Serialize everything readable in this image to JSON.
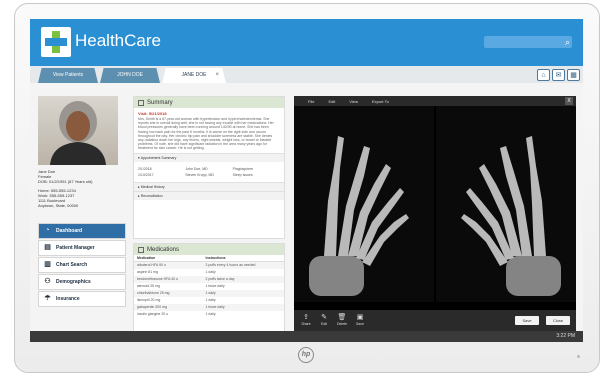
{
  "app": {
    "brand": "HealthCare"
  },
  "colors": {
    "topbar": "#2b8fd4",
    "nav_active": "#2f6fa6",
    "visit_date": "#c0392b"
  },
  "tabs": [
    {
      "label": "View Patients",
      "active": false
    },
    {
      "label": "JOHN DOE",
      "active": false
    },
    {
      "label": "JANE DOE",
      "active": true,
      "close": "×"
    }
  ],
  "header_icons": [
    "home-icon",
    "mail-icon",
    "calendar-icon"
  ],
  "patient": {
    "name": "Jane Doe",
    "gender": "Female",
    "dob": "DOB: 01/2/1951 (67 Years old)",
    "phone1": "Home: 555-555-1234",
    "phone2": "Work: 555-555-1237",
    "address1": "1111 Boulevard",
    "address2": "Anytown, State, 00000"
  },
  "nav": [
    {
      "label": "Dashboard",
      "icon": "dashboard-icon",
      "active": true
    },
    {
      "label": "Patient Manager",
      "icon": "patient-manager-icon",
      "active": false
    },
    {
      "label": "Chart Search",
      "icon": "chart-search-icon",
      "active": false
    },
    {
      "label": "Demographics",
      "icon": "demographics-icon",
      "active": false
    },
    {
      "label": "Insurance",
      "icon": "insurance-icon",
      "active": false
    }
  ],
  "summary": {
    "title": "Summary",
    "visit": "Visit: 5/21/2018",
    "note": "Mrs. Smith is a 67-year-old woman with hypertension and hypercholesterolemia. She reports she is overall doing well; she is not having any trouble with her medications. Her blood pressures generally have been running around 140/90 at home. She has been having low back pain for the past 6 months. It is worse on the right side and occurs throughout the day. Her chronic hip pain and shoulder soreness are stable. She denies any radiation down her legs, any fevers, night sweats, weight loss, or bowel or bladder problems. Of note, she did have significant radiation in the area many years ago for treatment for skin cancer. He is not getting.",
    "sections": [
      "Appointment Summary",
      "Medical History",
      "Reconciliation"
    ],
    "appointments": [
      {
        "date": "2/1/2018",
        "doctor": "John Doe, MD",
        "reason": "Plagiosphere"
      },
      {
        "date": "1/10/2017",
        "doctor": "Steven Kropp, MD",
        "reason": "Sleep Issues"
      }
    ]
  },
  "medications": {
    "title": "Medications",
    "headers": [
      "Medication",
      "Instructions"
    ],
    "rows": [
      [
        "albuterol HFA 90 u",
        "2 puffs every 4 hours as needed"
      ],
      [
        "aspirin 81 mg",
        "1 daily"
      ],
      [
        "beclomethasone HFA 40 u",
        "2 puffs twice a day"
      ],
      [
        "atenolol 25 mg",
        "1 twice daily"
      ],
      [
        "chlorthalidone 25 mg",
        "1 daily"
      ],
      [
        "lisinopril 20 mg",
        "1 daily"
      ],
      [
        "gabapentin 300 mg",
        "1 twice daily"
      ],
      [
        "insulin glargine 20 u",
        "1 daily"
      ]
    ]
  },
  "viewer": {
    "menu": [
      "File",
      "Edit",
      "View",
      "Export To"
    ],
    "close": "X",
    "tools": [
      {
        "label": "Share",
        "icon": "share-icon"
      },
      {
        "label": "Edit",
        "icon": "edit-icon"
      },
      {
        "label": "Delete",
        "icon": "delete-icon"
      },
      {
        "label": "Save",
        "icon": "save-icon"
      }
    ],
    "buttons": [
      "Save",
      "Close"
    ]
  },
  "status": {
    "time": "3:22 PM"
  }
}
